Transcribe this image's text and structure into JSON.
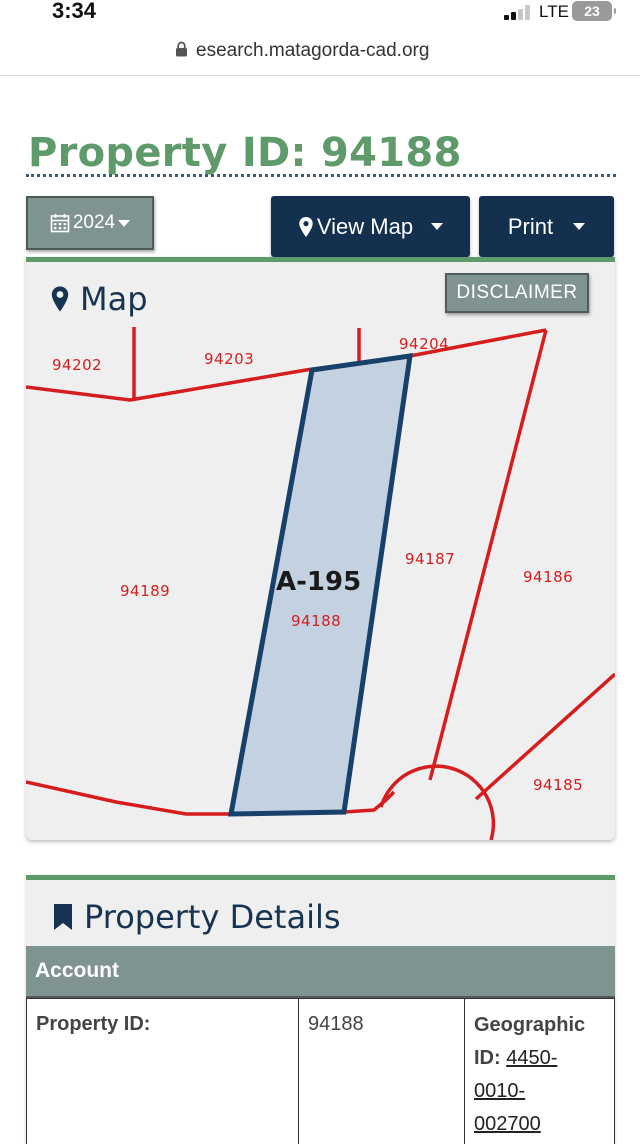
{
  "status_bar": {
    "time": "3:34",
    "network": "LTE",
    "battery": "23"
  },
  "browser": {
    "url": "esearch.matagorda-cad.org"
  },
  "page": {
    "title": "Property ID: 94188"
  },
  "toolbar": {
    "year_label": "2024",
    "view_map_label": "View Map",
    "print_label": "Print"
  },
  "map": {
    "heading": "Map",
    "disclaimer_label": "DISCLAIMER",
    "abstract_label": "A-195",
    "parcel_labels": [
      "94202",
      "94203",
      "94204",
      "94189",
      "94188",
      "94187",
      "94186",
      "94185"
    ],
    "colors": {
      "parcel_line": "#d61c1c",
      "selected_fill": "#c4d1e0",
      "selected_outline": "#17406a"
    }
  },
  "details": {
    "heading": "Property Details",
    "section_label": "Account",
    "property_id_label": "Property ID:",
    "property_id_value": "94188",
    "geographic_label_1": "Geographic",
    "geographic_label_2": "ID:",
    "geographic_id_parts": [
      "4450-",
      "0010-",
      "002700"
    ]
  },
  "colors": {
    "accent_green": "#5e9a6a",
    "navy": "#14304f",
    "slate": "#7f9391"
  },
  "icons": {
    "calendar": "calendar-icon",
    "map_marker": "map-marker-icon",
    "bookmark": "bookmark-icon",
    "lock": "lock-icon"
  }
}
